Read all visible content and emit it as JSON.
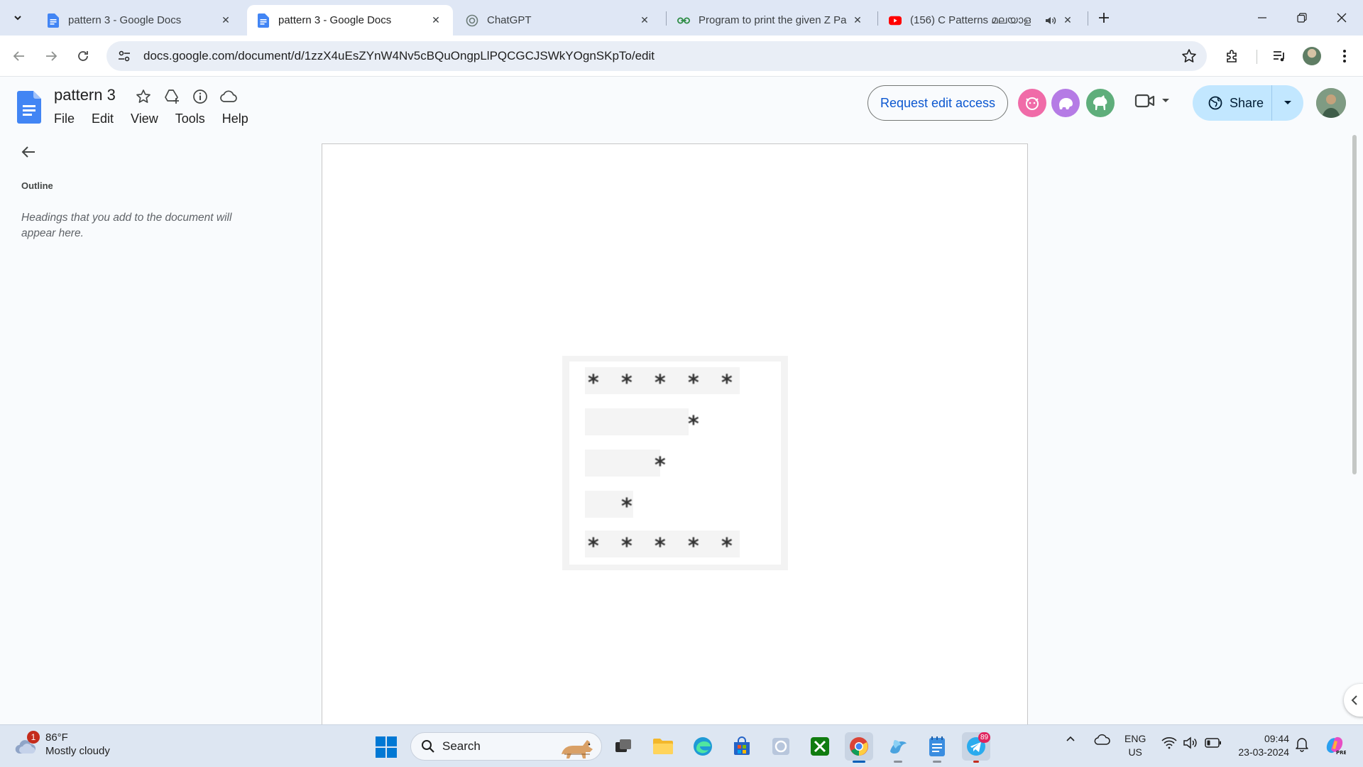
{
  "browser": {
    "tabs": [
      {
        "title": "pattern 3 - Google Docs",
        "icon": "google-docs-icon",
        "active": false
      },
      {
        "title": "pattern 3 - Google Docs",
        "icon": "google-docs-icon",
        "active": true
      },
      {
        "title": "ChatGPT",
        "icon": "chatgpt-icon",
        "active": false
      },
      {
        "title": "Program to print the given Z Pa",
        "icon": "geeksforgeeks-icon",
        "active": false
      },
      {
        "title": "(156) C Patterns മലയാള",
        "icon": "youtube-icon",
        "active": false,
        "audio": true
      }
    ],
    "url": "docs.google.com/document/d/1zzX4uEsZYnW4Nv5cBQuOngpLlPQCGCJSWkYOgnSKpTo/edit"
  },
  "docs": {
    "title": "pattern 3",
    "menu": [
      "File",
      "Edit",
      "View",
      "Tools",
      "Help"
    ],
    "request_edit_label": "Request edit access",
    "share_label": "Share",
    "viewer_colors": [
      "#f06ba8",
      "#b57be5",
      "#5fae7b"
    ]
  },
  "outline": {
    "title": "Outline",
    "empty_text": "Headings that you add to the document will appear here."
  },
  "document": {
    "pattern_rows": [
      [
        true,
        true,
        true,
        true,
        true
      ],
      [
        false,
        false,
        false,
        true,
        false
      ],
      [
        false,
        false,
        true,
        false,
        false
      ],
      [
        false,
        true,
        false,
        false,
        false
      ],
      [
        true,
        true,
        true,
        true,
        true
      ]
    ],
    "star_glyph": "*"
  },
  "taskbar": {
    "weather_temp": "86°F",
    "weather_desc": "Mostly cloudy",
    "weather_badge": "1",
    "search_label": "Search",
    "telegram_badge": "89",
    "lang_top": "ENG",
    "lang_bottom": "US",
    "time": "09:44",
    "date": "23-03-2024"
  }
}
